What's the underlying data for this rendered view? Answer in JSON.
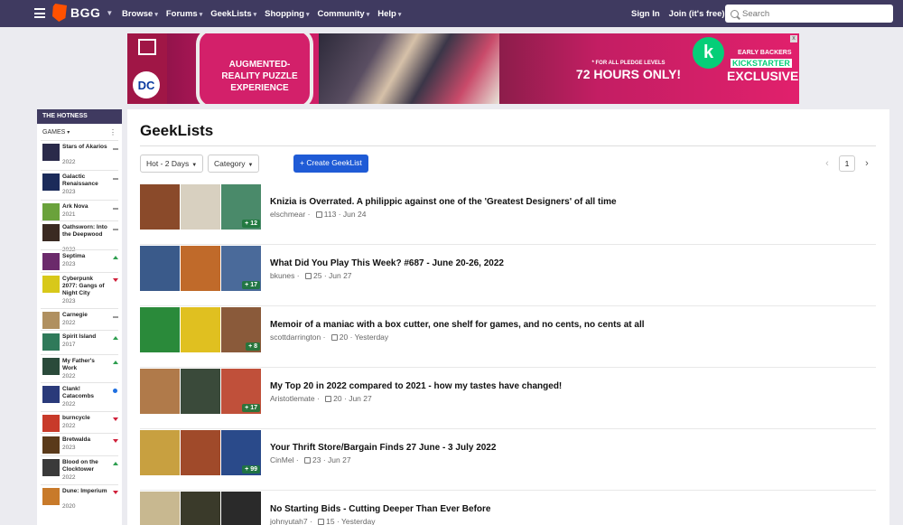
{
  "nav": {
    "logo": "BGG",
    "menu": [
      {
        "label": "Browse"
      },
      {
        "label": "Forums"
      },
      {
        "label": "GeekLists"
      },
      {
        "label": "Shopping"
      },
      {
        "label": "Community"
      },
      {
        "label": "Help"
      }
    ],
    "sign_in": "Sign In",
    "join": "Join (it's free)!",
    "search_placeholder": "Search"
  },
  "ad": {
    "phone_text": "AUGMENTED-REALITY PUZZLE EXPERIENCE",
    "dc_logo": "DC",
    "pledge_small": "* FOR ALL PLEDGE LEVELS",
    "hours": "72 HOURS ONLY!",
    "ks_logo": "k",
    "early": "EARLY BACKERS",
    "kickstarter": "KICKSTARTER",
    "exclusive": "EXCLUSIVE",
    "close": "x"
  },
  "sidebar": {
    "header": "THE HOTNESS",
    "games_label": "GAMES",
    "games_more": "⋮",
    "items": [
      {
        "name": "Stars of Akarios",
        "year": "2022",
        "trend": "flat",
        "color": "#2a2a4a"
      },
      {
        "name": "Galactic Renaissance",
        "year": "2023",
        "trend": "flat",
        "color": "#1b2b5a"
      },
      {
        "name": "Ark Nova",
        "year": "2021",
        "trend": "flat",
        "color": "#6aa23b"
      },
      {
        "name": "Oathsworn: Into the Deepwood",
        "year": "2022",
        "trend": "flat",
        "color": "#3a2a22"
      },
      {
        "name": "Septima",
        "year": "2023",
        "trend": "up",
        "color": "#6b2a6b"
      },
      {
        "name": "Cyberpunk 2077: Gangs of Night City",
        "year": "2023",
        "trend": "down",
        "color": "#d8c81a"
      },
      {
        "name": "Carnegie",
        "year": "2022",
        "trend": "flat",
        "color": "#b09060"
      },
      {
        "name": "Spirit Island",
        "year": "2017",
        "trend": "up",
        "color": "#2f7a5a"
      },
      {
        "name": "My Father's Work",
        "year": "2022",
        "trend": "up",
        "color": "#2a4a3a"
      },
      {
        "name": "Clank! Catacombs",
        "year": "2022",
        "trend": "new",
        "color": "#2a3a7a"
      },
      {
        "name": "burncycle",
        "year": "2022",
        "trend": "down",
        "color": "#c83a2a"
      },
      {
        "name": "Bretwalda",
        "year": "2023",
        "trend": "down",
        "color": "#5a3a1a"
      },
      {
        "name": "Blood on the Clocktower",
        "year": "2022",
        "trend": "up",
        "color": "#3a3a3a"
      },
      {
        "name": "Dune: Imperium",
        "year": "2020",
        "trend": "down",
        "color": "#c87a2a"
      }
    ]
  },
  "main": {
    "title": "GeekLists",
    "filter_hot": "Hot - 2 Days",
    "filter_category": "Category",
    "create_button": "+ Create GeekList",
    "page": "1",
    "prev": "‹",
    "next": "›",
    "lists": [
      {
        "title": "Knizia is Overrated. A philippic against one of the 'Greatest Designers' of all time",
        "author": "elschmear",
        "likes": "113",
        "date": "Jun 24",
        "more": "+ 12",
        "colors": [
          "#8a4a2a",
          "#d8d0c0",
          "#4a8a6a"
        ]
      },
      {
        "title": "What Did You Play This Week? #687 - June 20-26, 2022",
        "author": "bkunes",
        "likes": "25",
        "date": "Jun 27",
        "more": "+ 17",
        "colors": [
          "#3a5a8a",
          "#c06a2a",
          "#4a6a9a"
        ]
      },
      {
        "title": "Memoir of a maniac with a box cutter, one shelf for games, and no cents, no cents at all",
        "author": "scottdarrington",
        "likes": "20",
        "date": "Yesterday",
        "more": "+ 8",
        "colors": [
          "#2a8a3a",
          "#e0c020",
          "#8a5a3a"
        ]
      },
      {
        "title": "My Top 20 in 2022 compared to 2021 - how my tastes have changed!",
        "author": "Aristotlemate",
        "likes": "20",
        "date": "Jun 27",
        "more": "+ 17",
        "colors": [
          "#b07a4a",
          "#3a4a3a",
          "#c0503a"
        ]
      },
      {
        "title": "Your Thrift Store/Bargain Finds 27 June - 3 July 2022",
        "author": "CinMel",
        "likes": "23",
        "date": "Jun 27",
        "more": "+ 99",
        "colors": [
          "#c8a040",
          "#a04a2a",
          "#2a4a8a"
        ]
      },
      {
        "title": "No Starting Bids - Cutting Deeper Than Ever Before",
        "author": "johnyutah7",
        "likes": "15",
        "date": "Yesterday",
        "more": "",
        "colors": [
          "#c8b890",
          "#3a3a2a",
          "#2a2a2a"
        ]
      }
    ]
  }
}
